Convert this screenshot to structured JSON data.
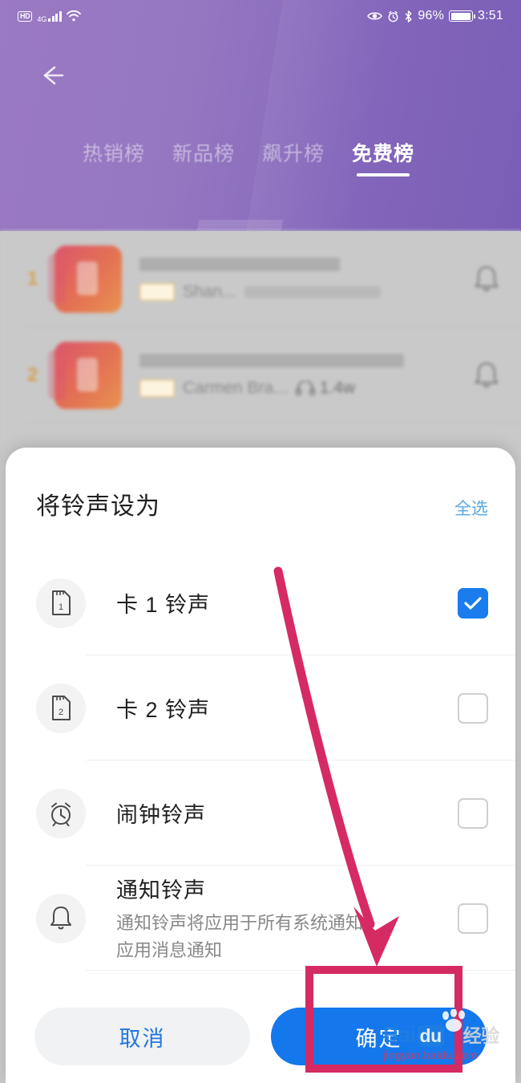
{
  "status_bar": {
    "hd_label": "HD",
    "network_label": "4G",
    "signal_icon": "signal-bars-icon",
    "wifi_icon": "wifi-icon",
    "eye_icon": "eye-icon",
    "alarm_icon": "alarm-icon",
    "bluetooth_icon": "bluetooth-icon",
    "battery_percent": "96%",
    "battery_icon": "battery-icon",
    "time": "3:51"
  },
  "app": {
    "back_icon": "back-arrow-icon",
    "header_color": "#8a68bc",
    "tabs": [
      {
        "label": "热销榜",
        "active": false
      },
      {
        "label": "新品榜",
        "active": false
      },
      {
        "label": "飙升榜",
        "active": false
      },
      {
        "label": "免费榜",
        "active": true
      }
    ],
    "rows": [
      {
        "rank": "1",
        "subtitle": "Shan...",
        "plays": "",
        "bell_icon": "bell-icon"
      },
      {
        "rank": "2",
        "subtitle": "Carmen Bra...",
        "plays": "1.4w",
        "bell_icon": "bell-icon"
      }
    ],
    "plays_icon": "headphones-icon"
  },
  "sheet": {
    "title": "将铃声设为",
    "select_all_label": "全选",
    "options": [
      {
        "icon": "sim-card-1-icon",
        "label": "卡 1 铃声",
        "desc": "",
        "checked": true
      },
      {
        "icon": "sim-card-2-icon",
        "label": "卡 2 铃声",
        "desc": "",
        "checked": false
      },
      {
        "icon": "alarm-clock-icon",
        "label": "闹钟铃声",
        "desc": "",
        "checked": false
      },
      {
        "icon": "notification-bell-icon",
        "label": "通知铃声",
        "desc": "通知铃声将应用于所有系统通知、应用消息通知",
        "checked": false
      }
    ],
    "cancel_label": "取消",
    "confirm_label": "确定",
    "accent_color": "#1477ec",
    "link_color": "#58a8e8"
  },
  "annotation": {
    "arrow_icon": "arrow-pointer-annotation",
    "arrow_color": "#d62a63",
    "highlight_color": "#d62a63"
  },
  "watermark": {
    "brand": "Bai",
    "brand_suffix": "du",
    "brand_cn": "经验",
    "url": "jingyan.baidu.com",
    "paw_icon": "paw-icon"
  }
}
